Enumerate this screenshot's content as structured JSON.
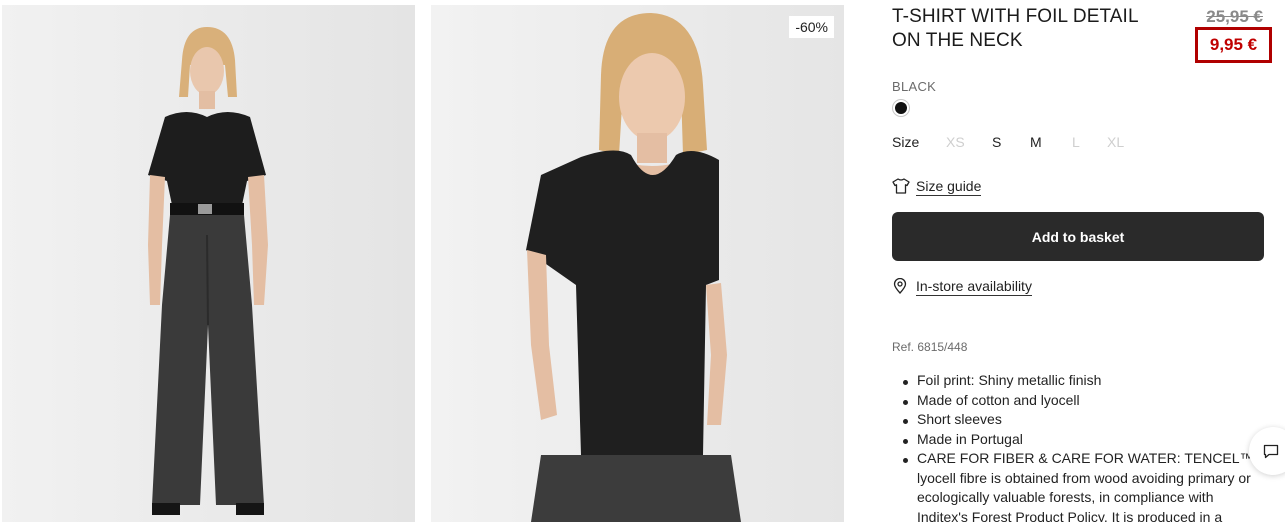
{
  "product": {
    "title": "T-SHIRT WITH FOIL DETAIL ON THE NECK",
    "old_price": "25,95 €",
    "new_price": "9,95 €",
    "discount_badge": "-60%",
    "color_name": "BLACK",
    "selected_color_hex": "#111111"
  },
  "sizes": {
    "label": "Size",
    "options": [
      {
        "label": "XS",
        "available": false
      },
      {
        "label": "S",
        "available": true
      },
      {
        "label": "M",
        "available": true
      },
      {
        "label": "L",
        "available": false
      },
      {
        "label": "XL",
        "available": false
      }
    ]
  },
  "links": {
    "size_guide": "Size guide",
    "in_store": "In-store availability"
  },
  "actions": {
    "add_to_basket": "Add to basket"
  },
  "details": {
    "ref": "Ref. 6815/448",
    "features": [
      "Foil print: Shiny metallic finish",
      "Made of cotton and lyocell",
      "Short sleeves",
      "Made in Portugal",
      "CARE FOR FIBER & CARE FOR WATER: TENCEL™ lyocell fibre is obtained from wood avoiding primary or ecologically valuable forests, in compliance with Inditex's Forest Product Policy. It is produced in a"
    ]
  },
  "colors": {
    "accent_red": "#c00000",
    "button_bg": "#2a2a2a"
  }
}
